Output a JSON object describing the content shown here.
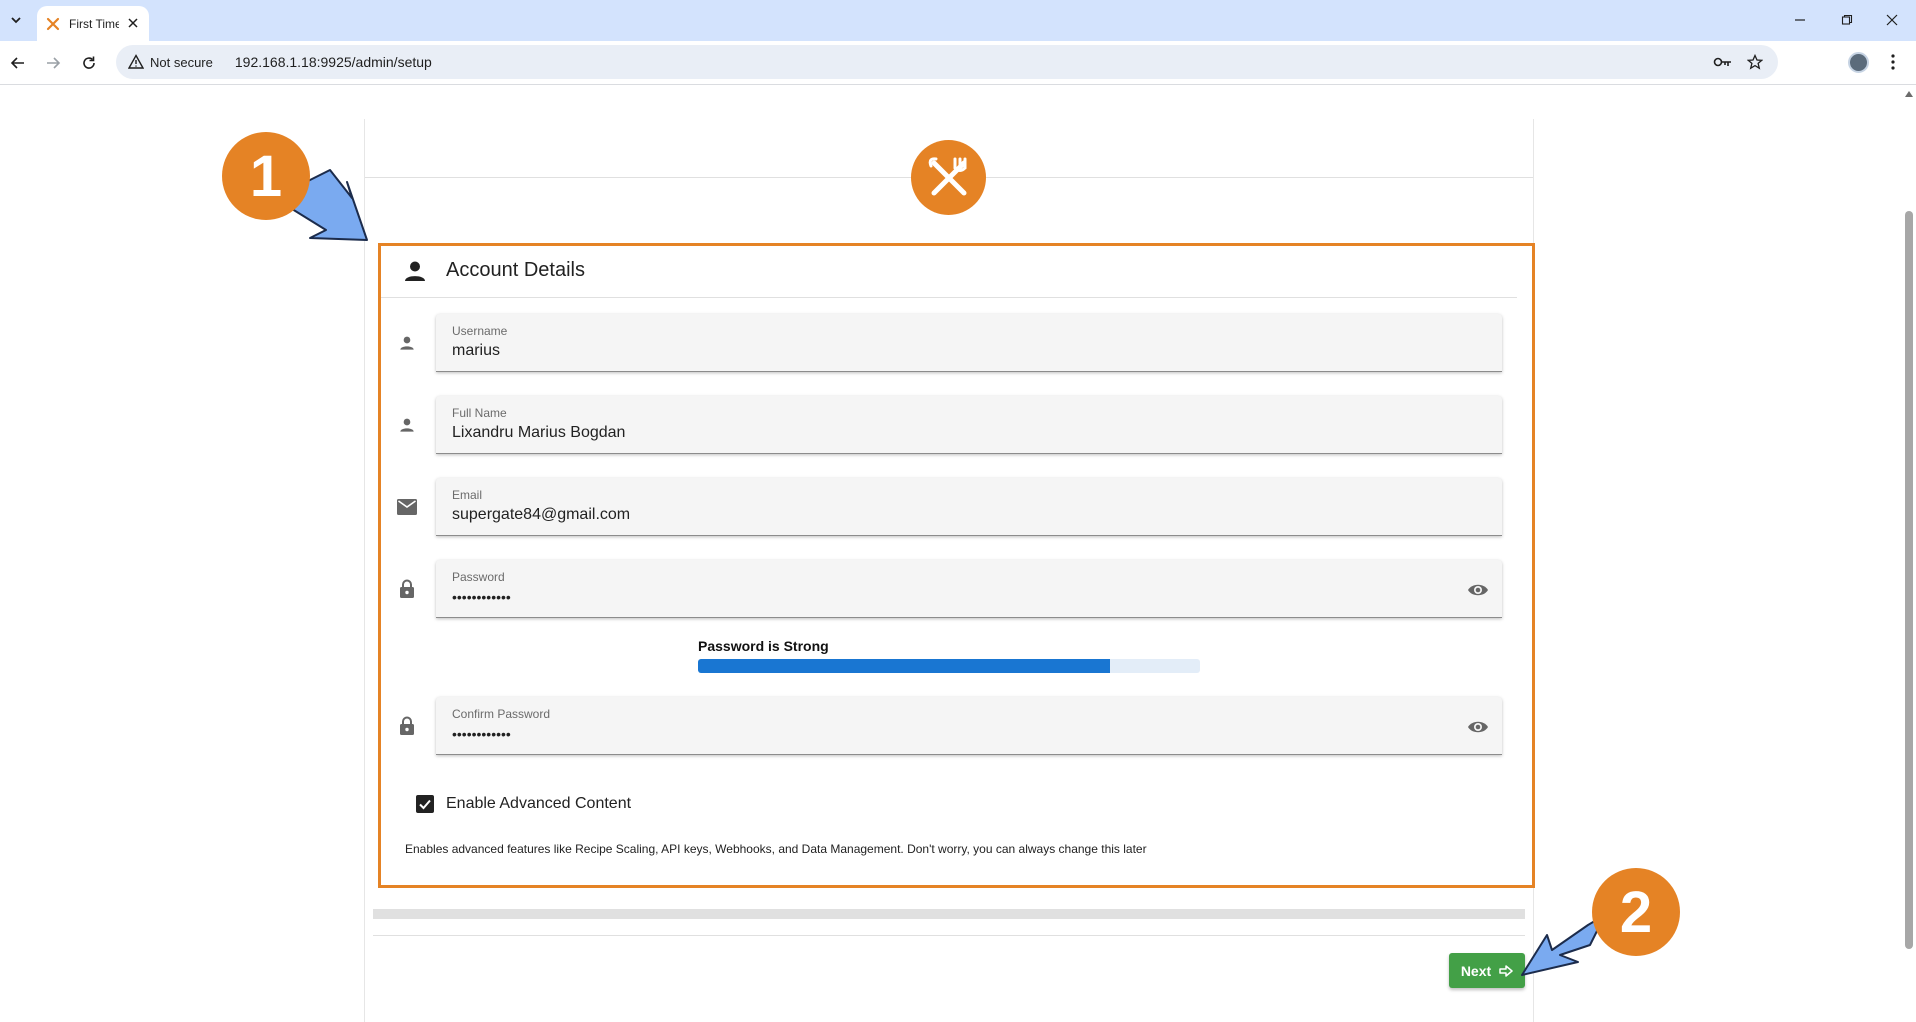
{
  "browser": {
    "tab_title": "First Time Setup",
    "security_label": "Not secure",
    "url": "192.168.1.18:9925/admin/setup"
  },
  "form": {
    "section_title": "Account Details",
    "username": {
      "label": "Username",
      "value": "marius"
    },
    "full_name": {
      "label": "Full Name",
      "value": "Lixandru Marius Bogdan"
    },
    "email": {
      "label": "Email",
      "value": "supergate84@gmail.com"
    },
    "password": {
      "label": "Password",
      "value": "••••••••••••"
    },
    "password_strength": {
      "label": "Password is Strong",
      "level": 0.82
    },
    "confirm_password": {
      "label": "Confirm Password",
      "value": "••••••••••••"
    },
    "advanced_content": {
      "label": "Enable Advanced Content",
      "checked": true,
      "help": "Enables advanced features like Recipe Scaling, API keys, Webhooks, and Data Management. Don't worry, you can always change this later"
    },
    "next_label": "Next"
  },
  "annotations": {
    "badge_1": "1",
    "badge_2": "2"
  },
  "colors": {
    "brand_orange": "#e58325",
    "primary_blue": "#1976d2",
    "next_green": "#43a047",
    "arrow_blue": "#7aaaf0"
  },
  "icons": [
    "tab-list-icon",
    "utensils-logo-icon",
    "close-icon",
    "minimize-icon",
    "restore-icon",
    "back-icon",
    "forward-icon",
    "reload-icon",
    "warning-icon",
    "key-icon",
    "star-icon",
    "more-icon",
    "person-icon",
    "mail-icon",
    "lock-icon",
    "eye-icon",
    "check-icon",
    "arrow-right-icon"
  ]
}
